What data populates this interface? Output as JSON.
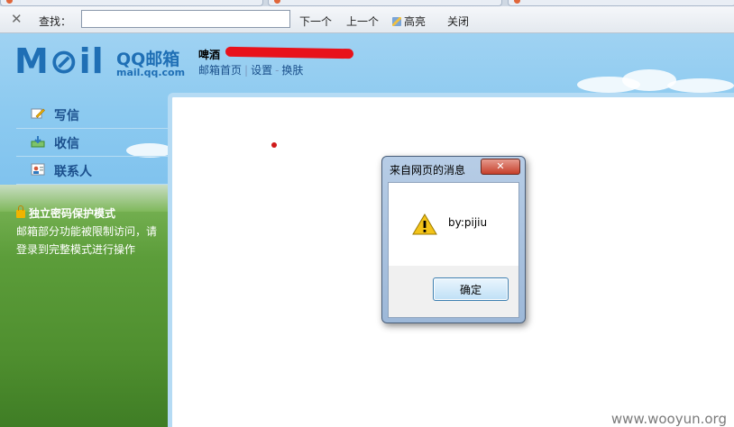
{
  "findbar": {
    "close_icon": "close-icon",
    "label": "查找：",
    "value": "",
    "next": "下一个",
    "prev": "上一个",
    "highlight": "高亮",
    "close": "关闭"
  },
  "header": {
    "logo_mark": "M⊘il",
    "logo_name": "QQ邮箱",
    "logo_domain": "mail.qq.com",
    "user_name": "啤酒",
    "links": [
      "邮箱首页",
      "设置",
      "换肤"
    ]
  },
  "sidebar": {
    "items": [
      {
        "label": "写信",
        "icon": "compose-icon"
      },
      {
        "label": "收信",
        "icon": "inbox-icon"
      },
      {
        "label": "联系人",
        "icon": "contacts-icon"
      }
    ],
    "secure_title": "独立密码保护模式",
    "secure_text": "邮箱部分功能被限制访问，请登录到完整模式进行操作"
  },
  "dialog": {
    "title": "来自网页的消息",
    "message": "by:pijiu",
    "ok": "确定",
    "close_glyph": "✕"
  },
  "watermark": "www.wooyun.org",
  "colors": {
    "brand": "#1f6fb5",
    "sky": "#8ccaf0",
    "grass": "#5c9d3a"
  }
}
